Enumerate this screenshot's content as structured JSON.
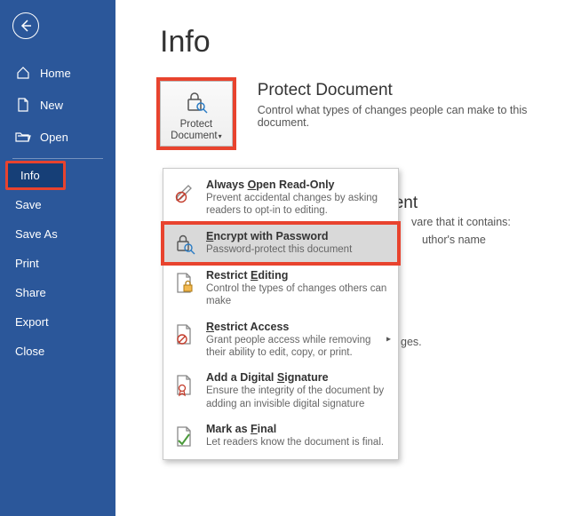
{
  "page_title": "Info",
  "sidebar": {
    "items": [
      {
        "label": "Home",
        "icon": "home"
      },
      {
        "label": "New",
        "icon": "doc"
      },
      {
        "label": "Open",
        "icon": "folder"
      },
      {
        "label": "Info"
      },
      {
        "label": "Save"
      },
      {
        "label": "Save As"
      },
      {
        "label": "Print"
      },
      {
        "label": "Share"
      },
      {
        "label": "Export"
      },
      {
        "label": "Close"
      }
    ]
  },
  "protect_section": {
    "button_label_top": "Protect",
    "button_label_bottom": "Document",
    "dropdown_char": "▾",
    "heading": "Protect Document",
    "subtext": "Control what types of changes people can make to this document."
  },
  "inspect_section": {
    "heading": "Inspect Document",
    "row1_fragment": "vare that it contains:",
    "bullet1_fragment": "uthor's name",
    "issues_fragment": "ges."
  },
  "dropdown": {
    "items": [
      {
        "title_pre": "Always ",
        "title_u": "O",
        "title_post": "pen Read-Only",
        "sub": "Prevent accidental changes by asking readers to opt-in to editing."
      },
      {
        "title_pre": "",
        "title_u": "E",
        "title_post": "ncrypt with Password",
        "sub": "Password-protect this document"
      },
      {
        "title_pre": "Restrict ",
        "title_u": "E",
        "title_post": "diting",
        "sub": "Control the types of changes others can make"
      },
      {
        "title_pre": "",
        "title_u": "R",
        "title_post": "estrict Access",
        "sub": "Grant people access while removing their ability to edit, copy, or print.",
        "arrow": "▸"
      },
      {
        "title_pre": "Add a Digital ",
        "title_u": "S",
        "title_post": "ignature",
        "sub": "Ensure the integrity of the document by adding an invisible digital signature"
      },
      {
        "title_pre": "Mark as ",
        "title_u": "F",
        "title_post": "inal",
        "sub": "Let readers know the document is final."
      }
    ]
  }
}
